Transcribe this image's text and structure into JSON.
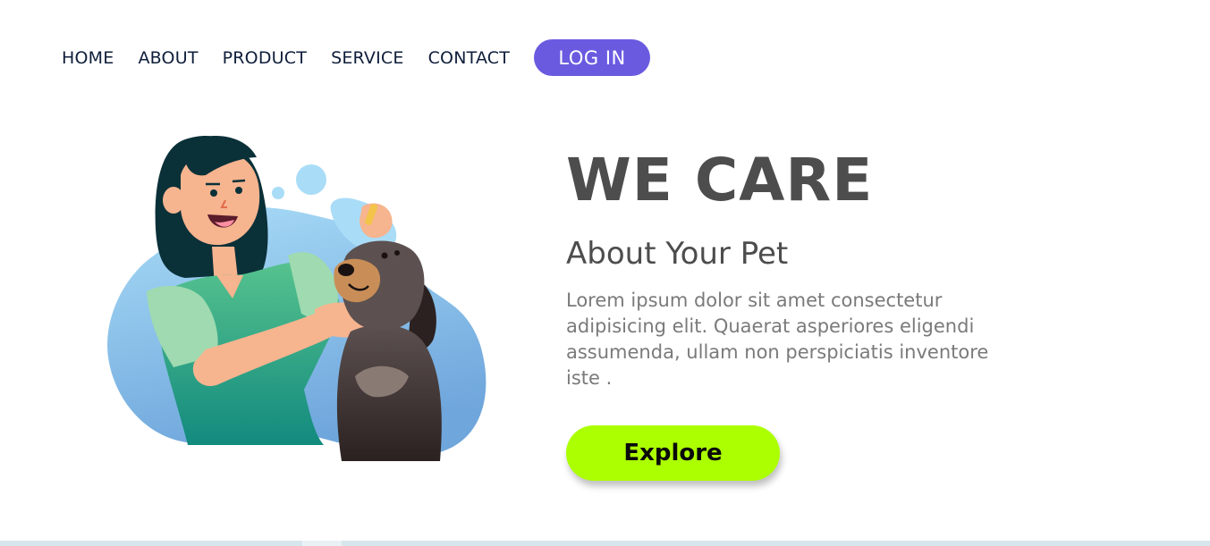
{
  "nav": {
    "items": [
      {
        "label": "HOME"
      },
      {
        "label": "ABOUT"
      },
      {
        "label": "PRODUCT"
      },
      {
        "label": "SERVICE"
      },
      {
        "label": "CONTACT"
      }
    ],
    "login_label": "LOG IN"
  },
  "hero": {
    "title": "WE CARE",
    "subtitle": "About Your Pet",
    "body": "Lorem ipsum dolor sit amet consectetur adipisicing elit. Quaerat asperiores eligendi assumenda, ullam non perspiciatis inventore iste .",
    "cta_label": "Explore"
  },
  "colors": {
    "accent": "#6a5ae0",
    "cta": "#acff00",
    "heading": "#4d4d4d",
    "body_text": "#7a7a7a",
    "nav_text": "#0f1e3a"
  },
  "icons": {
    "illustration": "woman-with-dog-illustration"
  }
}
